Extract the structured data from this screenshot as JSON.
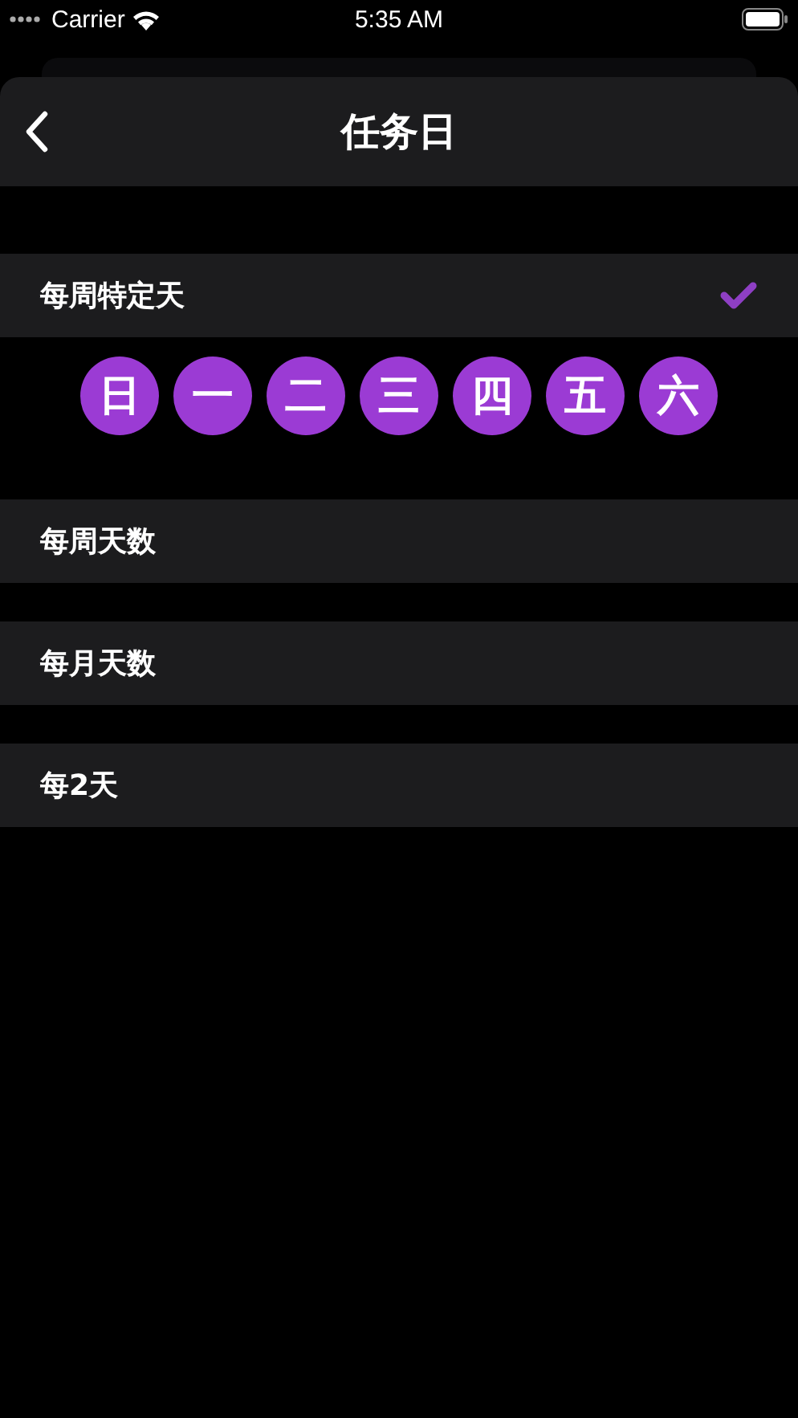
{
  "status_bar": {
    "carrier": "Carrier",
    "time": "5:35 AM"
  },
  "nav": {
    "title": "任务日"
  },
  "options": [
    {
      "label": "每周特定天",
      "selected": true,
      "days": [
        {
          "label": "日",
          "selected": true
        },
        {
          "label": "一",
          "selected": true
        },
        {
          "label": "二",
          "selected": true
        },
        {
          "label": "三",
          "selected": true
        },
        {
          "label": "四",
          "selected": true
        },
        {
          "label": "五",
          "selected": true
        },
        {
          "label": "六",
          "selected": true
        }
      ]
    },
    {
      "label": "每周天数",
      "selected": false
    },
    {
      "label": "每月天数",
      "selected": false
    },
    {
      "label": "每2天",
      "selected": false
    }
  ]
}
